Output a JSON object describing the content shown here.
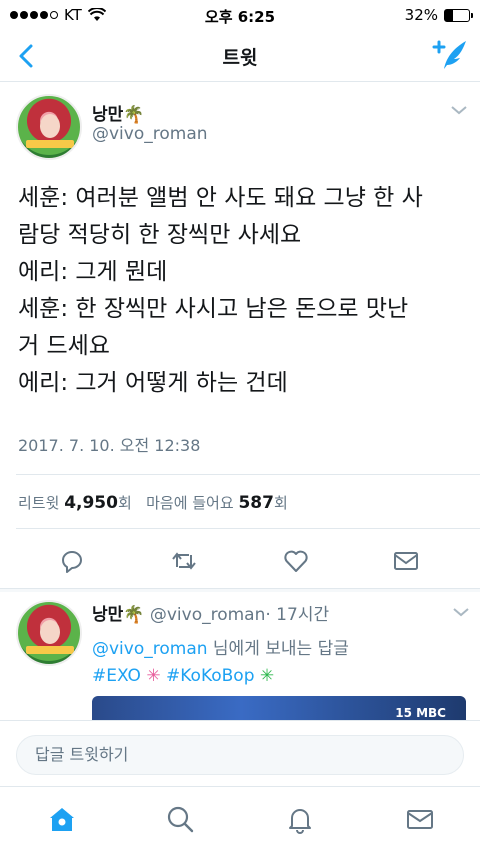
{
  "status_bar": {
    "carrier": "KT",
    "time": "오후 6:25",
    "battery": "32%",
    "battery_level": 0.32
  },
  "nav": {
    "title": "트윗"
  },
  "tweet": {
    "name": "낭만🌴",
    "handle": "@vivo_roman",
    "lines": [
      "세훈: 여러분 앨범 안 사도 돼요 그냥 한 사",
      "람당 적당히 한 장씩만 사세요",
      "에리: 그게 뭔데",
      "세훈: 한 장씩만 사시고 남은 돈으로 맛난",
      "거 드세요",
      "에리: 그거 어떻게 하는 건데"
    ],
    "timestamp": "2017. 7. 10. 오전 12:38",
    "retweets_label": "리트윗",
    "retweets_count": "4,950",
    "retweets_unit": "회",
    "likes_label": "마음에 들어요",
    "likes_count": "587",
    "likes_unit": "회"
  },
  "reply_tweet": {
    "name": "낭만🌴",
    "handle": "@vivo_roman",
    "time": "· 17시간",
    "reply_to_handle": "@vivo_roman",
    "reply_to_suffix": " 님에게 보내는 답글",
    "hashtag1": "#EXO",
    "hashtag2": "#KoKoBop",
    "media_logo": "15 MBC"
  },
  "reply_bar": {
    "placeholder": "답글 트윗하기"
  },
  "colors": {
    "accent": "#1da1f2",
    "secondary_text": "#657786",
    "divider": "#e1e8ed"
  },
  "icons": {
    "nav": [
      "back-icon",
      "compose-icon"
    ],
    "actions": [
      "reply-icon",
      "retweet-icon",
      "like-icon",
      "dm-icon"
    ],
    "tabs": [
      "home-icon",
      "search-icon",
      "notifications-icon",
      "messages-icon"
    ]
  }
}
